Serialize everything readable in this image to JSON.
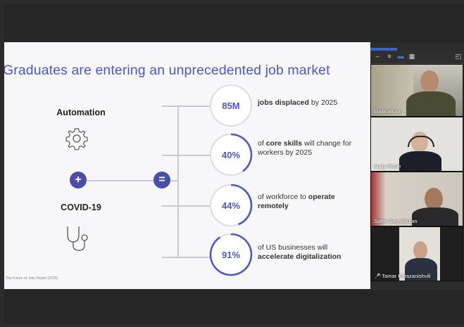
{
  "slide": {
    "title": "Graduates are entering an unprecedented job market",
    "left": {
      "automation_label": "Automation",
      "covid_label": "COVID-19",
      "plus_symbol": "+",
      "equals_symbol": "="
    },
    "stats": [
      {
        "value": "85M",
        "progress": 0,
        "pre": "",
        "bold": "jobs displaced",
        "post": " by 2025"
      },
      {
        "value": "40%",
        "progress": 0.4,
        "pre": "of ",
        "bold": "core skills",
        "post": " will change for workers by 2025"
      },
      {
        "value": "44%",
        "progress": 0.44,
        "pre": "of workforce to ",
        "bold": "operate remotely",
        "post": ""
      },
      {
        "value": "91%",
        "progress": 0.91,
        "pre": "of US businesses will ",
        "bold": "accelerate digitalization",
        "post": ""
      }
    ],
    "source": "The Future of Jobs Report (2020)",
    "accent_color": "#4a58c8",
    "dark_accent_color": "#4a4ea8"
  },
  "video_panel": {
    "participants": [
      {
        "name": "Malik alkan"
      },
      {
        "name": "Andy Poole"
      },
      {
        "name": "Saffet Bayraktutan"
      },
      {
        "name": "Tamar Karazanishvili"
      }
    ],
    "toolbar_icons": [
      "minimize-icon",
      "list-view-icon",
      "speaker-view-icon",
      "grid-view-icon",
      "fullscreen-icon"
    ]
  }
}
